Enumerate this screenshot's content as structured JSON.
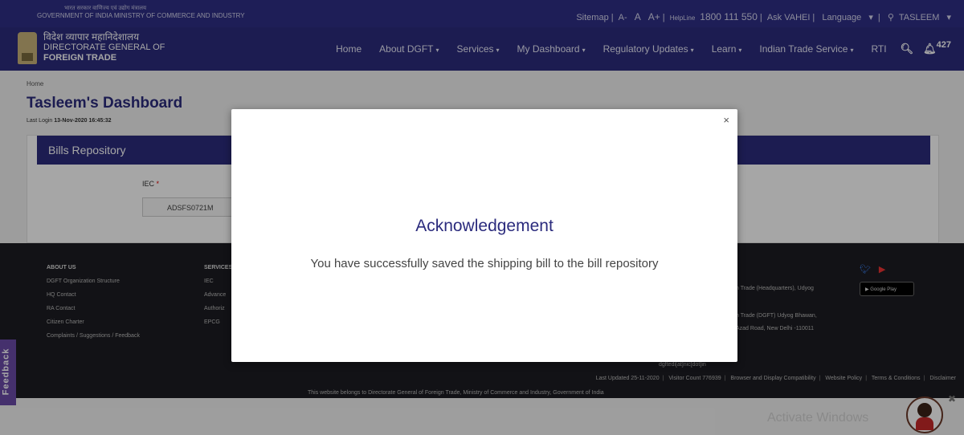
{
  "topbar": {
    "gov_hindi": "भारत सरकार  वाणिज्य एवं उद्योग मंत्रालय",
    "gov_english": "GOVERNMENT OF INDIA  MINISTRY OF COMMERCE AND INDUSTRY",
    "sitemap": "Sitemap",
    "font_small": "A-",
    "font_normal": "A",
    "font_large": "A+",
    "helpline_label": "HelpLine",
    "helpline_number": "1800 111 550",
    "ask_vahei": "Ask VAHEI",
    "language": "Language",
    "user": "TASLEEM"
  },
  "brand": {
    "hindi": "विदेश व्यापार महानिदेशालय",
    "line1": "DIRECTORATE GENERAL OF",
    "line2": "FOREIGN TRADE"
  },
  "nav": {
    "home": "Home",
    "about": "About DGFT",
    "services": "Services",
    "dashboard": "My Dashboard",
    "regulatory": "Regulatory Updates",
    "learn": "Learn",
    "its": "Indian Trade Service",
    "rti": "RTI",
    "notif_count": "427"
  },
  "breadcrumb": "Home",
  "page_title": "Tasleem's Dashboard",
  "last_login_label": "Last Login",
  "last_login_value": "13-Nov-2020 16:45:32",
  "bills": {
    "heading": "Bills Repository",
    "iec_label": "IEC",
    "iec_required": "*",
    "iec_value": "ADSFS0721M"
  },
  "footer": {
    "col1_head": "ABOUT US",
    "col1": [
      "DGFT Organization Structure",
      "HQ Contact",
      "RA Contact",
      "Citizen Charter",
      "Complaints / Suggestions / Feedback"
    ],
    "col2_head": "SERVICES",
    "col2": [
      "IEC",
      "Advance",
      "Authoriz",
      "EPCG"
    ],
    "addr1": "n Trade (Headquarters), Udyog",
    "addr2": "n Trade (DGFT) Udyog Bhawan,",
    "addr3": "Azad Road, New Delhi -110011",
    "email": "dgftedi[at]nic[dot]in",
    "google_play": "Google Play",
    "last_updated": "Last Updated 25-11-2020",
    "visitor_count": "Visitor Count  776939",
    "browser": "Browser and Display Compatibility",
    "policy": "Website Policy",
    "terms": "Terms & Conditions",
    "disclaimer": "Disclaimer",
    "owner": "This website belongs to Directorate General of Foreign Trade, Ministry of Commerce and Industry, Government of India"
  },
  "feedback_tab": "Feedback",
  "activate_windows": "Activate Windows",
  "modal": {
    "close": "×",
    "title": "Acknowledgement",
    "message": "You have successfully saved the shipping bill to the bill repository"
  }
}
